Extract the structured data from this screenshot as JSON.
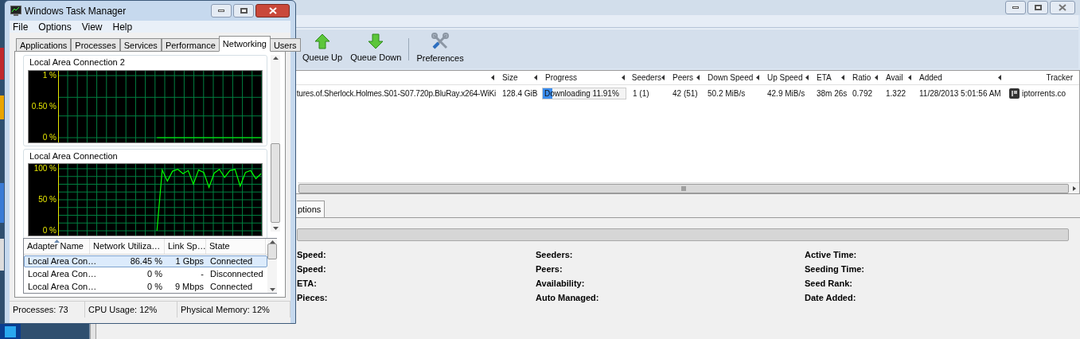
{
  "torrent_window": {
    "toolbar": [
      {
        "label": "Queue Up",
        "kind": "up"
      },
      {
        "label": "Queue Down",
        "kind": "down"
      },
      {
        "label": "Preferences",
        "kind": "prefs"
      }
    ],
    "table": {
      "columns": [
        {
          "kind": "name"
        },
        {
          "label": "Size",
          "kind": "text"
        },
        {
          "label": "Progress",
          "kind": "progress"
        },
        {
          "label": "Seeders",
          "kind": "text"
        },
        {
          "label": "Peers",
          "kind": "text"
        },
        {
          "label": "Down Speed",
          "kind": "text"
        },
        {
          "label": "Up Speed",
          "kind": "text"
        },
        {
          "label": "ETA",
          "kind": "text"
        },
        {
          "label": "Ratio",
          "kind": "text"
        },
        {
          "label": "Avail",
          "kind": "text"
        },
        {
          "label": "Added",
          "kind": "text"
        },
        {
          "label": "Tracker",
          "kind": "tracker"
        }
      ],
      "rows": [
        {
          "cells": [
            "tures.of.Sherlock.Holmes.S01-S07.720p.BluRay.x264-WiKi",
            "128.4 GiB",
            {
              "text": "Downloading 11.91%",
              "level": 0.1191
            },
            "1 (1)",
            "42 (51)",
            "50.2 MiB/s",
            "42.9 MiB/s",
            "38m 26s",
            "0.792",
            "1.322",
            "11/28/2013 5:01:56 AM",
            "iptorrents.co"
          ]
        }
      ]
    },
    "detail_tabs": [
      {
        "label": "ptions",
        "selected": true
      }
    ],
    "details": {
      "columns": [
        [
          "Speed:",
          "Speed:",
          "ETA:",
          "Pieces:"
        ],
        [
          "Seeders:",
          "Peers:",
          "Availability:",
          "Auto Managed:"
        ],
        [
          "Active Time:",
          "Seeding Time:",
          "Seed Rank:",
          "Date Added:"
        ]
      ]
    }
  },
  "task_manager": {
    "title": "Windows Task Manager",
    "menu": [
      "File",
      "Options",
      "View",
      "Help"
    ],
    "tabs": [
      {
        "label": "Applications",
        "selected": false
      },
      {
        "label": "Processes",
        "selected": false
      },
      {
        "label": "Services",
        "selected": false
      },
      {
        "label": "Performance",
        "selected": false
      },
      {
        "label": "Networking",
        "selected": true
      },
      {
        "label": "Users",
        "selected": false
      }
    ],
    "graphs": [
      {
        "chart_data": {
          "type": "line",
          "title": "Local Area Connection 2",
          "grid": true,
          "ylim": [
            0,
            1
          ],
          "yticks": [
            {
              "value": 0,
              "label": "0 %"
            },
            {
              "value": 0.5,
              "label": "0.50 %"
            },
            {
              "value": 1,
              "label": "1 %"
            }
          ],
          "series": [
            {
              "color": "#00ff00",
              "values": [
                null,
                null,
                null,
                null,
                null,
                null,
                null,
                null,
                null,
                null,
                null,
                null,
                null,
                null,
                null,
                null,
                null,
                null,
                null,
                0,
                0,
                0,
                0,
                0,
                0,
                0,
                0,
                0,
                0,
                0,
                0,
                0,
                0,
                0,
                0,
                0,
                0,
                0,
                0,
                0
              ]
            }
          ]
        }
      },
      {
        "chart_data": {
          "type": "line",
          "title": "Local Area Connection",
          "grid": true,
          "ylim": [
            0,
            100
          ],
          "yticks": [
            {
              "value": 0,
              "label": "0 %"
            },
            {
              "value": 50,
              "label": "50 %"
            },
            {
              "value": 100,
              "label": "100 %"
            }
          ],
          "series": [
            {
              "color": "#00ff00",
              "values": [
                null,
                null,
                null,
                null,
                null,
                null,
                null,
                null,
                null,
                null,
                null,
                null,
                null,
                null,
                null,
                null,
                null,
                null,
                null,
                0,
                98,
                80,
                96,
                99,
                92,
                97,
                75,
                98,
                94,
                70,
                93,
                99,
                86,
                97,
                99,
                72,
                94,
                97,
                84,
                92
              ]
            }
          ]
        }
      }
    ],
    "adapters": {
      "columns": [
        "Adapter Name",
        "Network Utiliza…",
        "Link Sp…",
        "State"
      ],
      "rows": [
        {
          "cells": [
            "Local Area Con…",
            "86.45 %",
            "1 Gbps",
            "Connected"
          ],
          "selected": true
        },
        {
          "cells": [
            "Local Area Con…",
            "0 %",
            "-",
            "Disconnected"
          ],
          "selected": false
        },
        {
          "cells": [
            "Local Area Con…",
            "0 %",
            "9 Mbps",
            "Connected"
          ],
          "selected": false
        }
      ]
    },
    "status_bar": [
      "Processes: 73",
      "CPU Usage: 12%",
      "Physical Memory: 12%"
    ]
  }
}
